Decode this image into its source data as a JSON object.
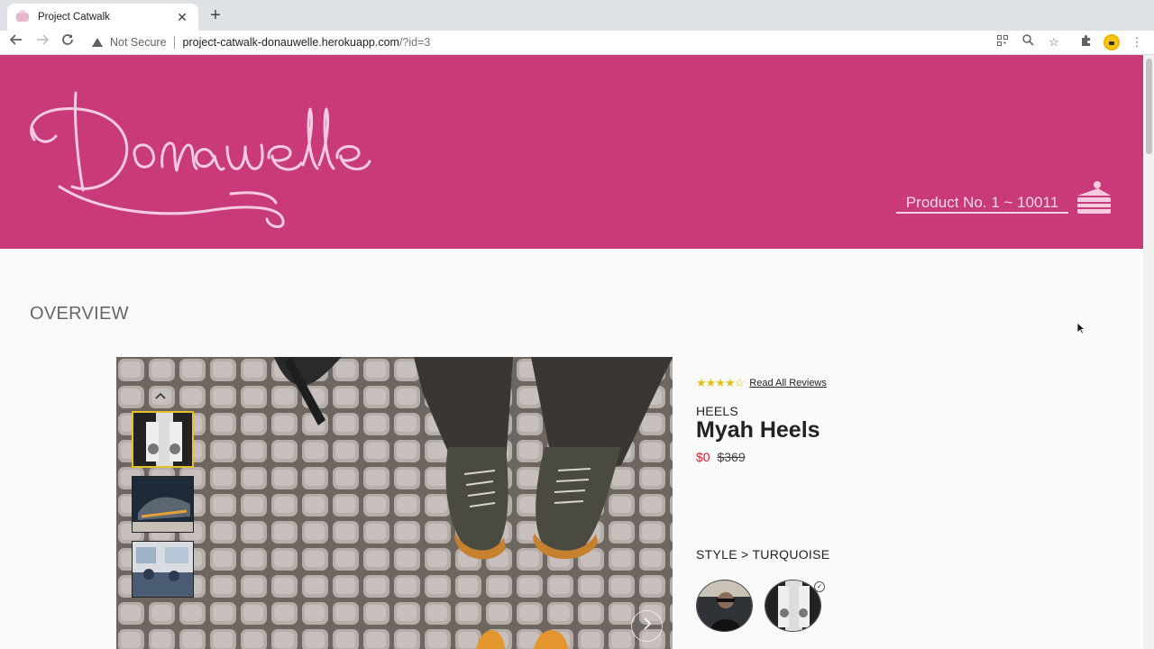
{
  "browser": {
    "tab_title": "Project Catwalk",
    "tab_close": "✕",
    "new_tab": "+",
    "not_secure": "Not Secure",
    "url_host": "project-catwalk-donauwelle.herokuapp.com",
    "url_path": "/?id=3"
  },
  "header": {
    "logo_text": "Donauwelle",
    "product_range": "Product No. 1 ~ 10011"
  },
  "overview": {
    "title": "OVERVIEW"
  },
  "product": {
    "rating": {
      "value": 3.5,
      "max": 5,
      "stars": "★★★★☆"
    },
    "read_reviews": "Read All Reviews",
    "category": "HEELS",
    "name": "Myah Heels",
    "sale_price": "$0",
    "original_price": "$369",
    "style_label": "STYLE > TURQUOISE"
  },
  "colors": {
    "header_bg": "#c83a7a",
    "sale_red": "#e0172a",
    "star": "#e2c21a",
    "thumb_active": "#e3c12a"
  }
}
